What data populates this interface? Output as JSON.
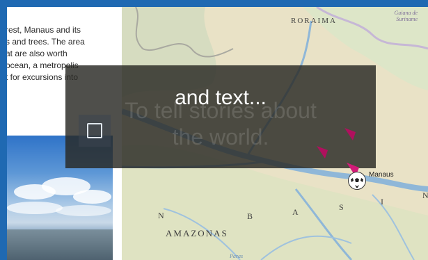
{
  "article": {
    "lines": [
      "rest, Manaus and its",
      "s and trees. The area",
      "at are also worth",
      "ocean, a metropolis",
      "t for excursions into"
    ]
  },
  "map": {
    "labels": {
      "roraima": "RORAIMA",
      "amazonas": "AMAZONAS",
      "manaus": "Manaus",
      "n1": "N",
      "b": "B",
      "a": "A",
      "s": "S",
      "i": "I",
      "n2": "N",
      "guiana": "Guiana de Suriname",
      "paras": "Paras"
    }
  },
  "overlay": {
    "title": "and text...",
    "ghost_line1": "To tell stories about",
    "ghost_line2": "the world."
  },
  "colors": {
    "frame": "#1f69b2",
    "marker": "#b0105e",
    "river": "#8fb7d8"
  }
}
